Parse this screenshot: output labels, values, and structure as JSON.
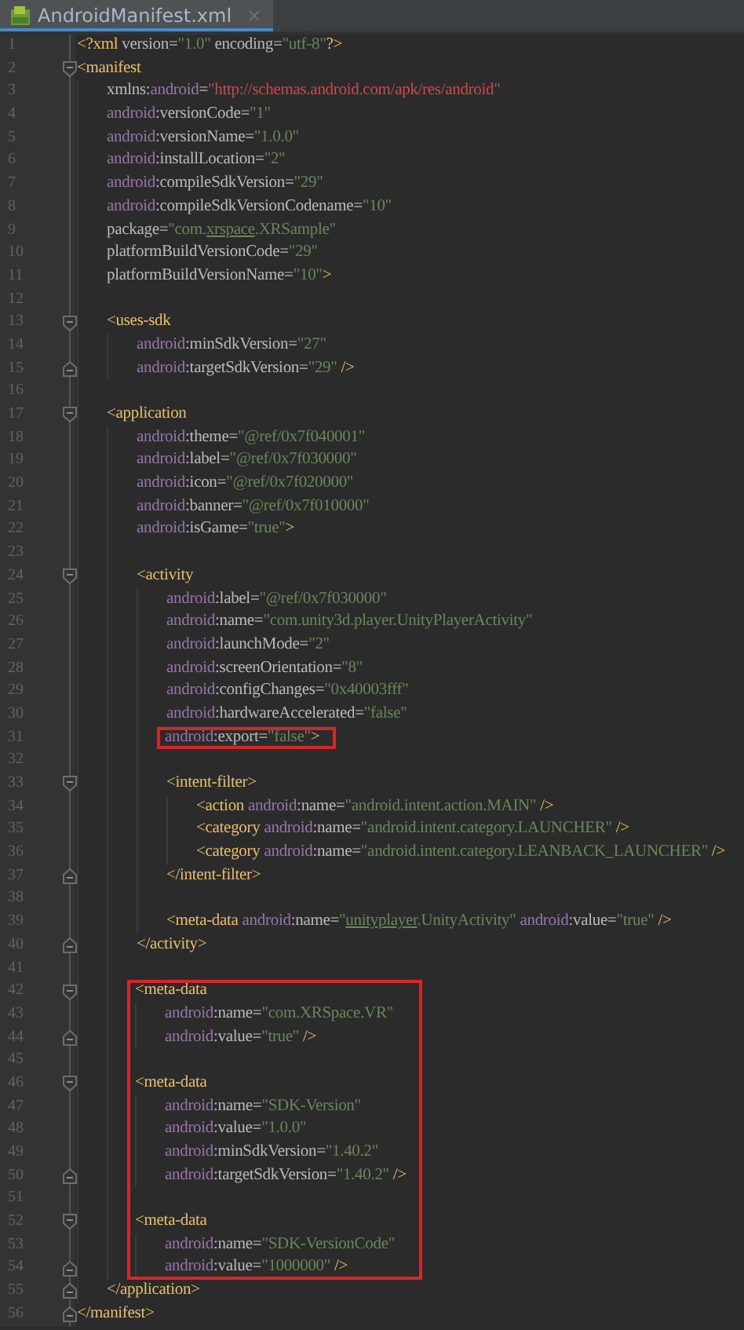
{
  "tab": {
    "title": "AndroidManifest.xml",
    "selected": true
  },
  "lines": [
    {
      "number": "1",
      "boxed": false,
      "tokens": [
        {
          "kind": "tag",
          "text": "<?xml"
        },
        {
          "kind": "attr",
          "text": " version="
        },
        {
          "kind": "value",
          "text": "\"1.0\""
        },
        {
          "kind": "attr",
          "text": " encoding="
        },
        {
          "kind": "value",
          "text": "\"utf-8\""
        },
        {
          "kind": "tag",
          "text": "?>"
        }
      ]
    },
    {
      "number": "2",
      "kind": "fold-start",
      "boxed": false,
      "tokens": [
        {
          "kind": "tag",
          "text": "<manifest"
        }
      ],
      "children": [
        {
          "number": "3",
          "boxed": false,
          "tokens": [
            {
              "kind": "attr",
              "text": "xmlns:"
            },
            {
              "kind": "ns",
              "text": "android"
            },
            {
              "kind": "attr",
              "text": "="
            },
            {
              "kind": "url",
              "text": "\"http://schemas.android.com/apk/res/android\""
            }
          ]
        },
        {
          "number": "4",
          "boxed": false,
          "tokens": [
            {
              "kind": "ns",
              "text": "android"
            },
            {
              "kind": "attr",
              "text": ":versionCode="
            },
            {
              "kind": "value",
              "text": "\"1\""
            }
          ]
        },
        {
          "number": "5",
          "boxed": false,
          "tokens": [
            {
              "kind": "ns",
              "text": "android"
            },
            {
              "kind": "attr",
              "text": ":versionName="
            },
            {
              "kind": "value",
              "text": "\"1.0.0\""
            }
          ]
        },
        {
          "number": "6",
          "boxed": false,
          "tokens": [
            {
              "kind": "ns",
              "text": "android"
            },
            {
              "kind": "attr",
              "text": ":installLocation="
            },
            {
              "kind": "value",
              "text": "\"2\""
            }
          ]
        },
        {
          "number": "7",
          "boxed": false,
          "tokens": [
            {
              "kind": "ns",
              "text": "android"
            },
            {
              "kind": "attr",
              "text": ":compileSdkVersion="
            },
            {
              "kind": "value",
              "text": "\"29\""
            }
          ]
        },
        {
          "number": "8",
          "boxed": false,
          "tokens": [
            {
              "kind": "ns",
              "text": "android"
            },
            {
              "kind": "attr",
              "text": ":compileSdkVersionCodename="
            },
            {
              "kind": "value",
              "text": "\"10\""
            }
          ]
        },
        {
          "number": "9",
          "boxed": false,
          "tokens": [
            {
              "kind": "attr",
              "text": "package="
            },
            {
              "kind": "value",
              "text": "\"com."
            },
            {
              "kind": "typo",
              "text": "xrspace"
            },
            {
              "kind": "value",
              "text": ".XRSample\""
            }
          ]
        },
        {
          "number": "10",
          "boxed": false,
          "tokens": [
            {
              "kind": "attr",
              "text": "platformBuildVersionCode="
            },
            {
              "kind": "value",
              "text": "\"29\""
            }
          ]
        },
        {
          "number": "11",
          "boxed": false,
          "tokens": [
            {
              "kind": "attr",
              "text": "platformBuildVersionName="
            },
            {
              "kind": "value",
              "text": "\"10\""
            },
            {
              "kind": "tag",
              "text": ">"
            }
          ]
        },
        {
          "number": "12",
          "boxed": false
        },
        {
          "number": "13",
          "kind": "fold-start",
          "boxed": false,
          "tokens": [
            {
              "kind": "tag",
              "text": "<uses-sdk"
            }
          ],
          "children": [
            {
              "number": "14",
              "boxed": false,
              "tokens": [
                {
                  "kind": "ns",
                  "text": "android"
                },
                {
                  "kind": "attr",
                  "text": ":minSdkVersion="
                },
                {
                  "kind": "value",
                  "text": "\"27\""
                }
              ]
            },
            {
              "number": "15",
              "kind": "fold-end",
              "boxed": false,
              "tokens": [
                {
                  "kind": "ns",
                  "text": "android"
                },
                {
                  "kind": "attr",
                  "text": ":targetSdkVersion="
                },
                {
                  "kind": "value",
                  "text": "\"29\""
                },
                {
                  "kind": "tag",
                  "text": " />"
                }
              ]
            }
          ]
        },
        {
          "number": "16",
          "boxed": false
        },
        {
          "number": "17",
          "kind": "fold-start",
          "boxed": false,
          "tokens": [
            {
              "kind": "tag",
              "text": "<application"
            }
          ],
          "children": [
            {
              "number": "18",
              "boxed": false,
              "tokens": [
                {
                  "kind": "ns",
                  "text": "android"
                },
                {
                  "kind": "attr",
                  "text": ":theme="
                },
                {
                  "kind": "value",
                  "text": "\"@ref/0x7f040001\""
                }
              ]
            },
            {
              "number": "19",
              "boxed": false,
              "tokens": [
                {
                  "kind": "ns",
                  "text": "android"
                },
                {
                  "kind": "attr",
                  "text": ":label="
                },
                {
                  "kind": "value",
                  "text": "\"@ref/0x7f030000\""
                }
              ]
            },
            {
              "number": "20",
              "boxed": false,
              "tokens": [
                {
                  "kind": "ns",
                  "text": "android"
                },
                {
                  "kind": "attr",
                  "text": ":icon="
                },
                {
                  "kind": "value",
                  "text": "\"@ref/0x7f020000\""
                }
              ]
            },
            {
              "number": "21",
              "boxed": false,
              "tokens": [
                {
                  "kind": "ns",
                  "text": "android"
                },
                {
                  "kind": "attr",
                  "text": ":banner="
                },
                {
                  "kind": "value",
                  "text": "\"@ref/0x7f010000\""
                }
              ]
            },
            {
              "number": "22",
              "boxed": false,
              "tokens": [
                {
                  "kind": "ns",
                  "text": "android"
                },
                {
                  "kind": "attr",
                  "text": ":isGame="
                },
                {
                  "kind": "value",
                  "text": "\"true\""
                },
                {
                  "kind": "tag",
                  "text": ">"
                }
              ]
            },
            {
              "number": "23",
              "boxed": false
            },
            {
              "number": "24",
              "kind": "fold-start",
              "boxed": false,
              "tokens": [
                {
                  "kind": "tag",
                  "text": "<activity"
                }
              ],
              "children": [
                {
                  "number": "25",
                  "boxed": false,
                  "tokens": [
                    {
                      "kind": "ns",
                      "text": "android"
                    },
                    {
                      "kind": "attr",
                      "text": ":label="
                    },
                    {
                      "kind": "value",
                      "text": "\"@ref/0x7f030000\""
                    }
                  ]
                },
                {
                  "number": "26",
                  "boxed": false,
                  "tokens": [
                    {
                      "kind": "ns",
                      "text": "android"
                    },
                    {
                      "kind": "attr",
                      "text": ":name="
                    },
                    {
                      "kind": "value",
                      "text": "\"com.unity3d.player.UnityPlayerActivity\""
                    }
                  ]
                },
                {
                  "number": "27",
                  "boxed": false,
                  "tokens": [
                    {
                      "kind": "ns",
                      "text": "android"
                    },
                    {
                      "kind": "attr",
                      "text": ":launchMode="
                    },
                    {
                      "kind": "value",
                      "text": "\"2\""
                    }
                  ]
                },
                {
                  "number": "28",
                  "boxed": false,
                  "tokens": [
                    {
                      "kind": "ns",
                      "text": "android"
                    },
                    {
                      "kind": "attr",
                      "text": ":screenOrientation="
                    },
                    {
                      "kind": "value",
                      "text": "\"8\""
                    }
                  ]
                },
                {
                  "number": "29",
                  "boxed": false,
                  "tokens": [
                    {
                      "kind": "ns",
                      "text": "android"
                    },
                    {
                      "kind": "attr",
                      "text": ":configChanges="
                    },
                    {
                      "kind": "value",
                      "text": "\"0x40003fff\""
                    }
                  ]
                },
                {
                  "number": "30",
                  "boxed": false,
                  "tokens": [
                    {
                      "kind": "ns",
                      "text": "android"
                    },
                    {
                      "kind": "attr",
                      "text": ":hardwareAccelerated="
                    },
                    {
                      "kind": "value",
                      "text": "\"false\""
                    }
                  ]
                },
                {
                  "number": "31",
                  "boxed": true,
                  "tokens": [
                    {
                      "kind": "ns",
                      "text": "android"
                    },
                    {
                      "kind": "attr",
                      "text": ":export="
                    },
                    {
                      "kind": "value",
                      "text": "\"false\""
                    },
                    {
                      "kind": "tag",
                      "text": ">"
                    }
                  ]
                },
                {
                  "number": "32",
                  "boxed": false
                },
                {
                  "number": "33",
                  "kind": "fold-start",
                  "boxed": false,
                  "tokens": [
                    {
                      "kind": "tag",
                      "text": "<intent-filter>"
                    }
                  ],
                  "children": [
                    {
                      "number": "34",
                      "boxed": false,
                      "tokens": [
                        {
                          "kind": "tag",
                          "text": "<action "
                        },
                        {
                          "kind": "ns",
                          "text": "android"
                        },
                        {
                          "kind": "attr",
                          "text": ":name="
                        },
                        {
                          "kind": "value",
                          "text": "\"android.intent.action.MAIN\""
                        },
                        {
                          "kind": "tag",
                          "text": " />"
                        }
                      ]
                    },
                    {
                      "number": "35",
                      "boxed": false,
                      "tokens": [
                        {
                          "kind": "tag",
                          "text": "<category "
                        },
                        {
                          "kind": "ns",
                          "text": "android"
                        },
                        {
                          "kind": "attr",
                          "text": ":name="
                        },
                        {
                          "kind": "value",
                          "text": "\"android.intent.category.LAUNCHER\""
                        },
                        {
                          "kind": "tag",
                          "text": " />"
                        }
                      ]
                    },
                    {
                      "number": "36",
                      "boxed": false,
                      "tokens": [
                        {
                          "kind": "tag",
                          "text": "<category "
                        },
                        {
                          "kind": "ns",
                          "text": "android"
                        },
                        {
                          "kind": "attr",
                          "text": ":name="
                        },
                        {
                          "kind": "value",
                          "text": "\"android.intent.category.LEANBACK_LAUNCHER\""
                        },
                        {
                          "kind": "tag",
                          "text": " />"
                        }
                      ]
                    }
                  ]
                },
                {
                  "number": "37",
                  "kind": "fold-end",
                  "boxed": false,
                  "tokens": [
                    {
                      "kind": "tag",
                      "text": "</intent-filter>"
                    }
                  ]
                },
                {
                  "number": "38",
                  "boxed": false
                },
                {
                  "number": "39",
                  "boxed": false,
                  "tokens": [
                    {
                      "kind": "tag",
                      "text": "<meta-data "
                    },
                    {
                      "kind": "ns",
                      "text": "android"
                    },
                    {
                      "kind": "attr",
                      "text": ":name="
                    },
                    {
                      "kind": "value",
                      "text": "\""
                    },
                    {
                      "kind": "typo",
                      "text": "unityplayer"
                    },
                    {
                      "kind": "value",
                      "text": ".UnityActivity\""
                    },
                    {
                      "kind": "ns",
                      "text": " android"
                    },
                    {
                      "kind": "attr",
                      "text": ":value="
                    },
                    {
                      "kind": "value",
                      "text": "\"true\""
                    },
                    {
                      "kind": "tag",
                      "text": " />"
                    }
                  ]
                }
              ]
            },
            {
              "number": "40",
              "kind": "fold-end",
              "boxed": false,
              "tokens": [
                {
                  "kind": "tag",
                  "text": "</activity>"
                }
              ]
            },
            {
              "number": "41",
              "boxed": false
            },
            {
              "number": "42",
              "kind": "fold-start",
              "boxed": true,
              "tokens": [
                {
                  "kind": "tag",
                  "text": "<meta-data"
                }
              ],
              "children": [
                {
                  "number": "43",
                  "boxed": false,
                  "tokens": [
                    {
                      "kind": "ns",
                      "text": "android"
                    },
                    {
                      "kind": "attr",
                      "text": ":name="
                    },
                    {
                      "kind": "value",
                      "text": "\"com.XRSpace.VR\""
                    }
                  ]
                },
                {
                  "number": "44",
                  "kind": "fold-end",
                  "boxed": false,
                  "tokens": [
                    {
                      "kind": "ns",
                      "text": "android"
                    },
                    {
                      "kind": "attr",
                      "text": ":value="
                    },
                    {
                      "kind": "value",
                      "text": "\"true\""
                    },
                    {
                      "kind": "tag",
                      "text": " />"
                    }
                  ]
                }
              ]
            },
            {
              "number": "45",
              "boxed": true
            },
            {
              "number": "46",
              "kind": "fold-start",
              "boxed": true,
              "tokens": [
                {
                  "kind": "tag",
                  "text": "<meta-data"
                }
              ],
              "children": [
                {
                  "number": "47",
                  "boxed": false,
                  "tokens": [
                    {
                      "kind": "ns",
                      "text": "android"
                    },
                    {
                      "kind": "attr",
                      "text": ":name="
                    },
                    {
                      "kind": "value",
                      "text": "\"SDK-Version\""
                    }
                  ]
                },
                {
                  "number": "48",
                  "boxed": false,
                  "tokens": [
                    {
                      "kind": "ns",
                      "text": "android"
                    },
                    {
                      "kind": "attr",
                      "text": ":value="
                    },
                    {
                      "kind": "value",
                      "text": "\"1.0.0\""
                    }
                  ]
                },
                {
                  "number": "49",
                  "boxed": false,
                  "tokens": [
                    {
                      "kind": "ns",
                      "text": "android"
                    },
                    {
                      "kind": "attr",
                      "text": ":minSdkVersion="
                    },
                    {
                      "kind": "value",
                      "text": "\"1.40.2\""
                    }
                  ]
                },
                {
                  "number": "50",
                  "kind": "fold-end",
                  "boxed": false,
                  "tokens": [
                    {
                      "kind": "ns",
                      "text": "android"
                    },
                    {
                      "kind": "attr",
                      "text": ":targetSdkVersion="
                    },
                    {
                      "kind": "value",
                      "text": "\"1.40.2\""
                    },
                    {
                      "kind": "tag",
                      "text": " />"
                    }
                  ]
                }
              ]
            },
            {
              "number": "51",
              "boxed": true
            },
            {
              "number": "52",
              "kind": "fold-start",
              "boxed": true,
              "tokens": [
                {
                  "kind": "tag",
                  "text": "<meta-data"
                }
              ],
              "children": [
                {
                  "number": "53",
                  "boxed": false,
                  "tokens": [
                    {
                      "kind": "ns",
                      "text": "android"
                    },
                    {
                      "kind": "attr",
                      "text": ":name="
                    },
                    {
                      "kind": "value",
                      "text": "\"SDK-VersionCode\""
                    }
                  ]
                },
                {
                  "number": "54",
                  "kind": "fold-end",
                  "boxed": false,
                  "tokens": [
                    {
                      "kind": "ns",
                      "text": "android"
                    },
                    {
                      "kind": "attr",
                      "text": ":value="
                    },
                    {
                      "kind": "value",
                      "text": "\"1000000\""
                    },
                    {
                      "kind": "tag",
                      "text": " />"
                    }
                  ]
                }
              ]
            }
          ]
        },
        {
          "number": "55",
          "kind": "fold-end",
          "boxed": false,
          "tokens": [
            {
              "kind": "tag",
              "text": "</application>"
            }
          ]
        }
      ]
    },
    {
      "number": "56",
      "kind": "fold-end",
      "boxed": false,
      "tokens": [
        {
          "kind": "tag",
          "text": "</manifest>"
        }
      ]
    }
  ]
}
